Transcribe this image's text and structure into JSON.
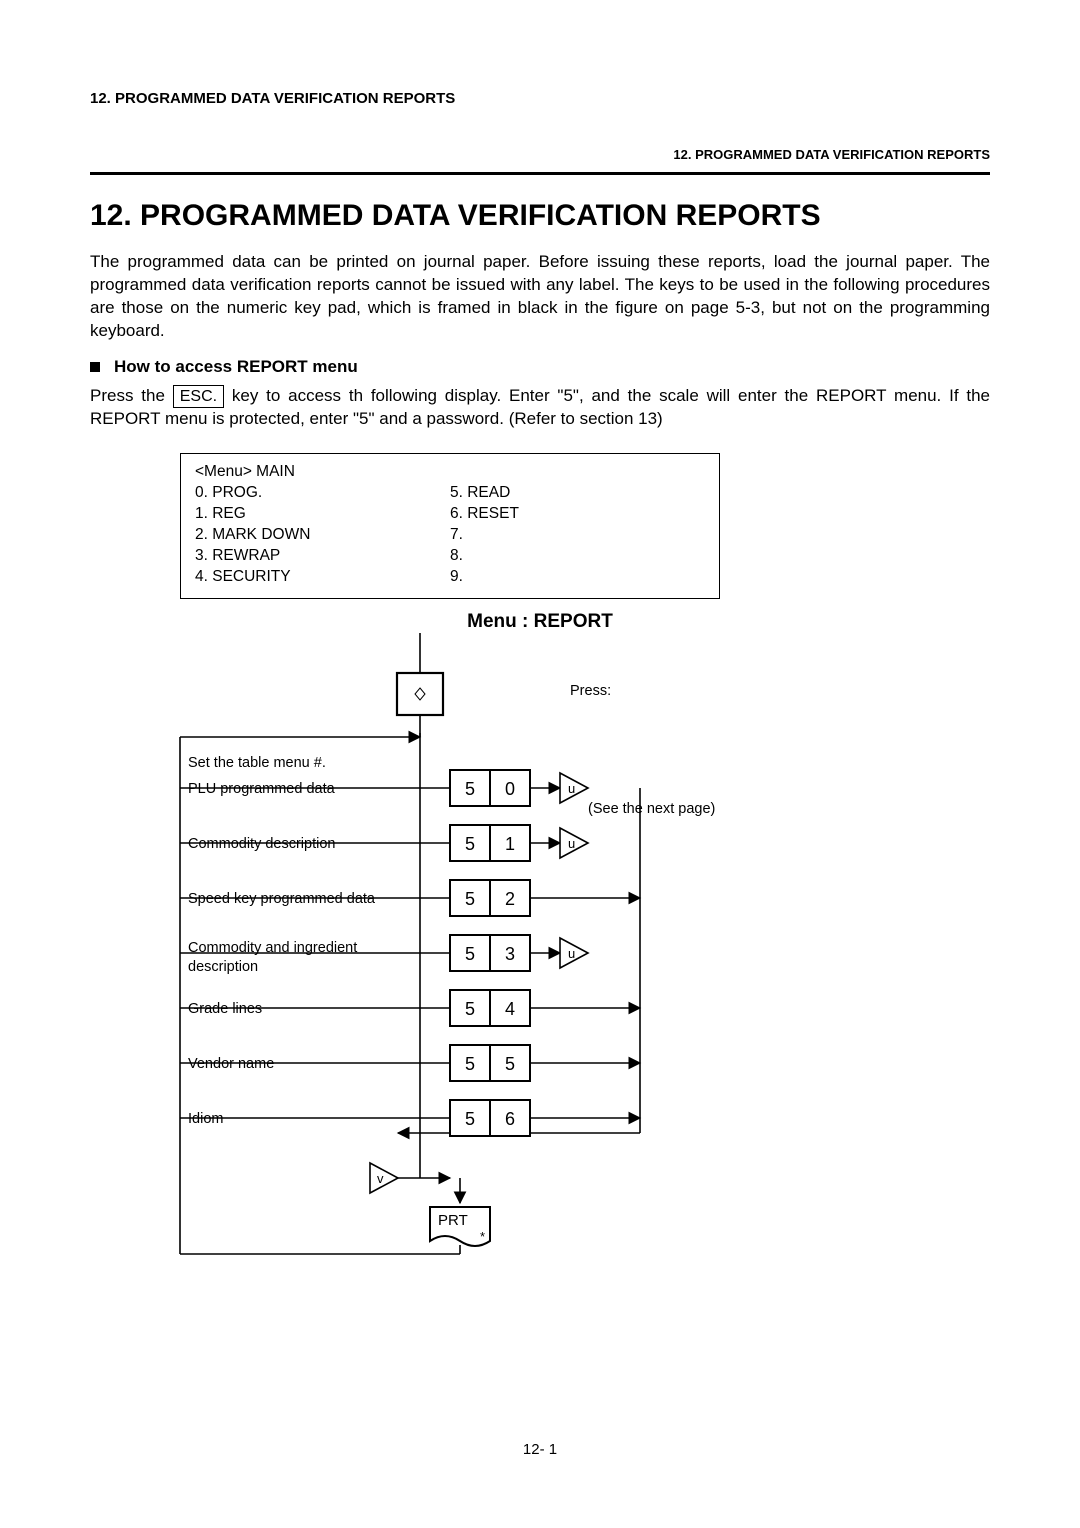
{
  "header": {
    "left": "12.  PROGRAMMED DATA VERIFICATION REPORTS",
    "right": "12. PROGRAMMED DATA VERIFICATION REPORTS"
  },
  "title": "12.  PROGRAMMED DATA VERIFICATION REPORTS",
  "paragraph1": "The programmed data can be printed on journal paper.   Before issuing these reports, load the journal paper.   The programmed data verification reports cannot be issued with any label.   The keys to be used in the following procedures are those on the numeric key pad, which is framed in black in the figure on page 5-3, but not on the programming keyboard.",
  "subheading": "How to access REPORT menu",
  "paragraph2_a": "Press the ",
  "esc_key": "ESC.",
  "paragraph2_b": " key to access th following display.   Enter \"5\", and the scale will enter the REPORT menu.   If the REPORT menu is protected, enter \"5\" and a password.   (Refer to section 13)",
  "menu_box": {
    "line1": "<Menu>   MAIN",
    "left": [
      "0.  PROG.",
      "1.  REG",
      "2.  MARK DOWN",
      "3.  REWRAP",
      "4.  SECURITY"
    ],
    "right": [
      "5.  READ",
      "6.  RESET",
      "7.",
      "8.",
      "9."
    ]
  },
  "flow": {
    "title": "Menu :   REPORT",
    "press": "Press:",
    "see_next": "(See the next page)",
    "rows": [
      {
        "label": "Set the table menu #.",
        "k1": "",
        "k2": "",
        "u": false
      },
      {
        "label": "PLU programmed data",
        "k1": "5",
        "k2": "0",
        "u": true
      },
      {
        "label": "Commodity description",
        "k1": "5",
        "k2": "1",
        "u": true
      },
      {
        "label": "Speed key programmed data",
        "k1": "5",
        "k2": "2",
        "u": false
      },
      {
        "label": "Commodity and ingredient description",
        "k1": "5",
        "k2": "3",
        "u": true
      },
      {
        "label": "Grade lines",
        "k1": "5",
        "k2": "4",
        "u": false
      },
      {
        "label": "Vendor name",
        "k1": "5",
        "k2": "5",
        "u": false
      },
      {
        "label": "Idiom",
        "k1": "5",
        "k2": "6",
        "u": false
      }
    ],
    "v_label": "v",
    "u_label": "u",
    "prt_label": "PRT",
    "star": "*"
  },
  "page_number": "12- 1"
}
